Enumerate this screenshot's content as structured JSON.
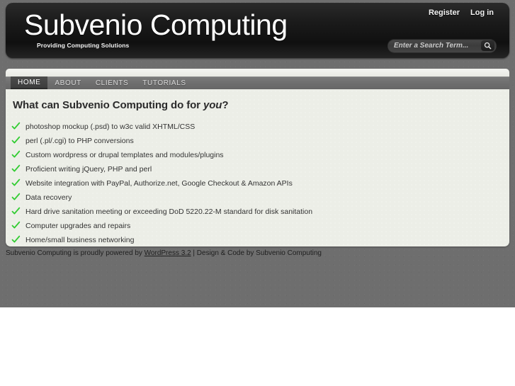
{
  "site": {
    "title": "Subvenio Computing",
    "tagline": "Providing Computing Solutions"
  },
  "account": {
    "register_label": "Register",
    "login_label": "Log in"
  },
  "search": {
    "placeholder": "Enter a Search Term...",
    "value": "",
    "icon": "search-icon"
  },
  "nav": {
    "items": [
      {
        "label": "HOME",
        "current": true
      },
      {
        "label": "ABOUT",
        "current": false
      },
      {
        "label": "CLIENTS",
        "current": false
      },
      {
        "label": "TUTORIALS",
        "current": false
      }
    ]
  },
  "main": {
    "heading_prefix": "What can Subvenio Computing do for ",
    "heading_emphasis": "you",
    "heading_suffix": "?",
    "services": [
      "photoshop mockup (.psd) to w3c valid XHTML/CSS",
      "perl (.pl/.cgi) to PHP conversions",
      "Custom wordpress or drupal templates and modules/plugins",
      "Proficient writing jQuery, PHP and perl",
      "Website integration with PayPal, Authorize.net, Google Checkout & Amazon APIs",
      "Data recovery",
      "Hard drive sanitation meeting or exceeding DoD 5220.22-M standard for disk sanitation",
      "Computer upgrades and repairs",
      "Home/small business networking"
    ],
    "bullet_icon": "checkmark-icon",
    "bullet_color": "#33cc33"
  },
  "footer": {
    "text_before_link": "Subvenio Computing is proudly powered by ",
    "link_label": "WordPress 3.2",
    "text_after_link": " | Design & Code by Subvenio Computing"
  }
}
